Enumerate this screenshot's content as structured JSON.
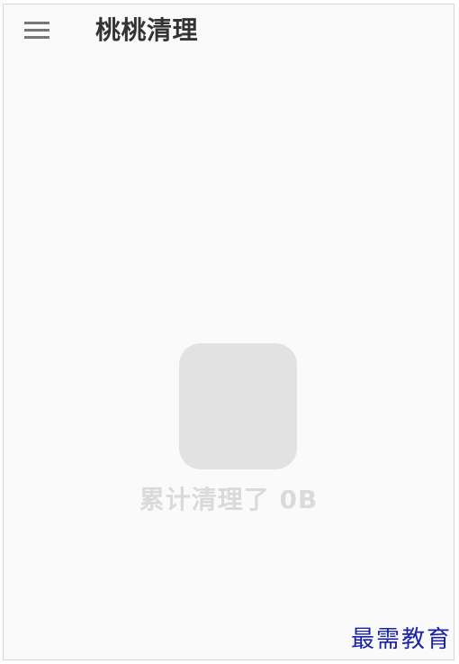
{
  "app_bar": {
    "menu_icon": "hamburger-menu-icon",
    "title": "桃桃清理"
  },
  "main": {
    "app_icon": "app-placeholder-icon",
    "summary_text": "累计清理了 0B"
  },
  "watermark": {
    "text": "最需教育"
  },
  "colors": {
    "background": "#fafafa",
    "title": "#333333",
    "icon_placeholder": "#e2e2e2",
    "summary_text": "#dadada",
    "watermark": "#1a22a8"
  }
}
